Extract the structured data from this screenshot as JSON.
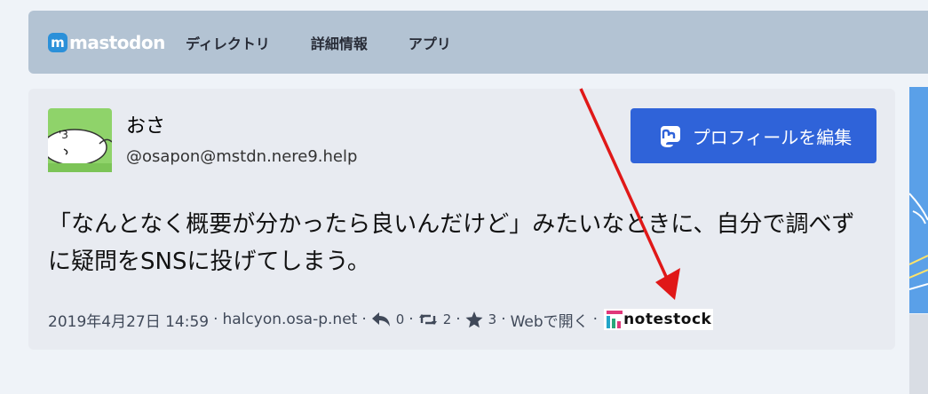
{
  "header": {
    "logo_text": "mastodon",
    "nav": [
      {
        "label": "ディレクトリ"
      },
      {
        "label": "詳細情報"
      },
      {
        "label": "アプリ"
      }
    ]
  },
  "profile": {
    "display_name": "おさ",
    "acct": "@osapon@mstdn.nere9.help",
    "edit_button_label": "プロフィールを編集"
  },
  "status": {
    "content": "「なんとなく概要が分かったら良いんだけど」みたいなときに、自分で調べずに疑問をSNSに投げてしまう。",
    "date": "2019年4月27日 14:59",
    "app": "halcyon.osa-p.net",
    "replies": "0",
    "boosts": "2",
    "favourites": "3",
    "open_web": "Webで開く",
    "separator": "·",
    "notestock_label": "notestock"
  },
  "colors": {
    "header_bg": "#b3c3d3",
    "button_bg": "#2f63d9",
    "annotation_arrow": "#e01818"
  },
  "icons": {
    "logo": "mastodon-logo-icon",
    "reply": "reply-icon",
    "boost": "retweet-icon",
    "favourite": "star-icon",
    "notestock": "notestock-logo-icon"
  }
}
